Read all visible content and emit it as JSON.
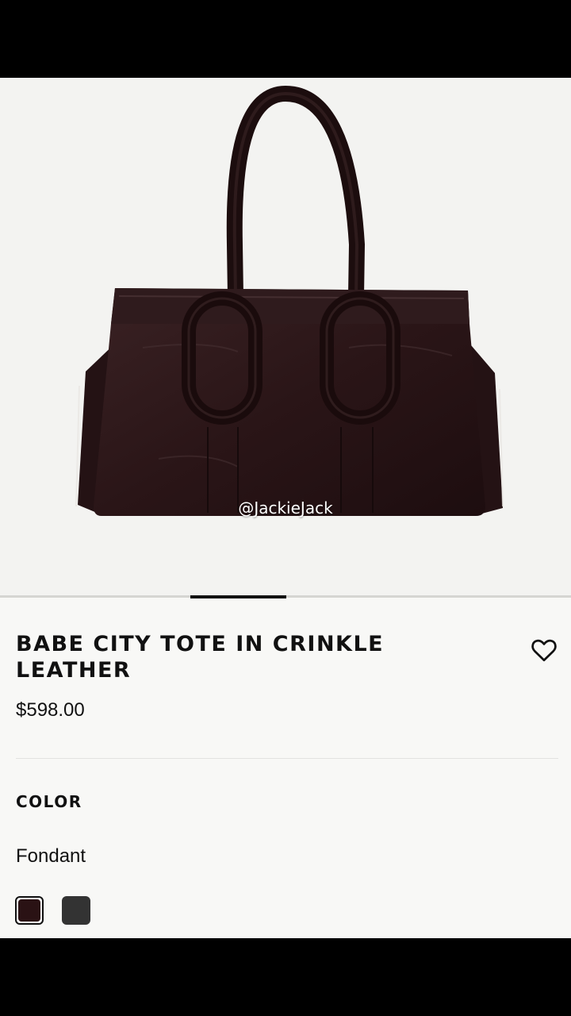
{
  "product": {
    "image_alt": "Babe City Tote in crinkle leather, dark brown",
    "watermark": "@JackieJack",
    "carousel": {
      "current_index": 3,
      "total": 6
    },
    "title": "BABE CITY TOTE IN CRINKLE LEATHER",
    "price": "$598.00",
    "wishlist_icon": "heart-outline-icon"
  },
  "color": {
    "label": "COLOR",
    "selected_name": "Fondant",
    "swatches": [
      {
        "name": "Fondant",
        "hex": "#2a1214",
        "selected": true
      },
      {
        "name": "Black",
        "hex": "#333333",
        "selected": false
      }
    ]
  }
}
